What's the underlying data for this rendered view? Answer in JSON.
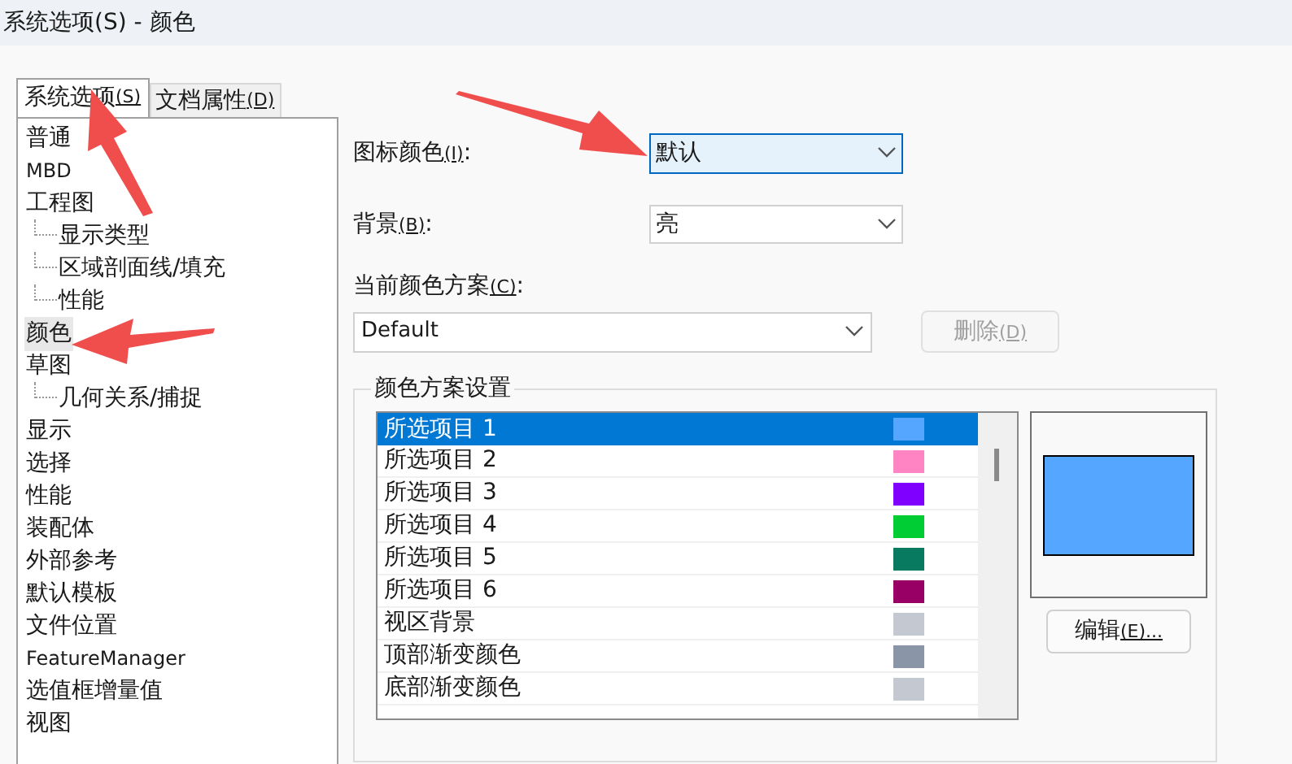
{
  "window": {
    "title": "系统选项(S) - 颜色"
  },
  "tabs": [
    {
      "label": "系统选项",
      "mnemonic": "(S)",
      "selected": true
    },
    {
      "label": "文档属性",
      "mnemonic": "(D)",
      "selected": false
    }
  ],
  "tree": [
    {
      "label": "普通",
      "selected": false
    },
    {
      "label": "MBD",
      "selected": false
    },
    {
      "label": "工程图",
      "selected": false,
      "children": [
        {
          "label": "显示类型",
          "selected": false
        },
        {
          "label": "区域剖面线/填充",
          "selected": false
        },
        {
          "label": "性能",
          "selected": false
        }
      ]
    },
    {
      "label": "颜色",
      "selected": true
    },
    {
      "label": "草图",
      "selected": false,
      "children": [
        {
          "label": "几何关系/捕捉",
          "selected": false
        }
      ]
    },
    {
      "label": "显示",
      "selected": false
    },
    {
      "label": "选择",
      "selected": false
    },
    {
      "label": "性能",
      "selected": false
    },
    {
      "label": "装配体",
      "selected": false
    },
    {
      "label": "外部参考",
      "selected": false
    },
    {
      "label": "默认模板",
      "selected": false
    },
    {
      "label": "文件位置",
      "selected": false
    },
    {
      "label": "FeatureManager",
      "selected": false
    },
    {
      "label": "选值框增量值",
      "selected": false
    },
    {
      "label": "视图",
      "selected": false
    }
  ],
  "icon_color": {
    "label": "图标颜色",
    "mnemonic": "(I)",
    "colon": ":",
    "value": "默认"
  },
  "background": {
    "label": "背景",
    "mnemonic": "(B)",
    "colon": ":",
    "value": "亮"
  },
  "scheme": {
    "label": "当前颜色方案",
    "mnemonic": "(C)",
    "colon": ":",
    "value": "Default"
  },
  "delete_button": {
    "label": "删除",
    "mnemonic": "(D)",
    "disabled": true
  },
  "scheme_settings": {
    "title": "颜色方案设置",
    "items": [
      {
        "label": "所选项目 1",
        "color": "#55a6fe",
        "selected": true
      },
      {
        "label": "所选项目 2",
        "color": "#ff84c4",
        "selected": false
      },
      {
        "label": "所选项目 3",
        "color": "#8000ff",
        "selected": false
      },
      {
        "label": "所选项目 4",
        "color": "#00cc33",
        "selected": false
      },
      {
        "label": "所选项目 5",
        "color": "#087a60",
        "selected": false
      },
      {
        "label": "所选项目 6",
        "color": "#990066",
        "selected": false
      },
      {
        "label": "视区背景",
        "color": "#c4c8d0",
        "selected": false
      },
      {
        "label": "顶部渐变颜色",
        "color": "#8a96a8",
        "selected": false
      },
      {
        "label": "底部渐变颜色",
        "color": "#c4c8d0",
        "selected": false
      }
    ],
    "edit_button": {
      "label": "编辑",
      "mnemonic": "(E)..."
    }
  }
}
